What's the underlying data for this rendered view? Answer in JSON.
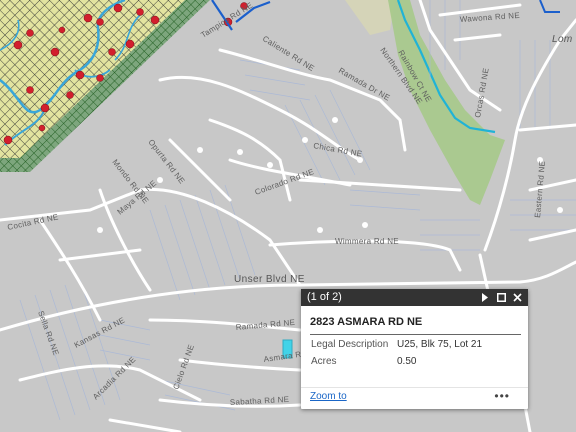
{
  "map": {
    "district_label": "Lom",
    "road_labels": {
      "tampico": "Tampico Rd NE",
      "caliente": "Caliente Rd NE",
      "mondo": "Mondo Rd NE",
      "ramada": "Ramada Dr NE",
      "chica": "Chica Rd NE",
      "taliaferro": "Taliaferro Rd NE",
      "opurta": "Opurta Rd NE",
      "maya": "Maya Rd NE",
      "cocita": "Cocita Rd NE",
      "sacadia": "Sacadia Rd NE",
      "colorado": "Colorado Rd NE",
      "wimmera": "Wimmera Rd NE",
      "unser": "Unser Blvd NE",
      "rainbow": "Rainbow Ct NE",
      "orcas": "Orcas Rd NE",
      "peterson": "Peterson Rd NE",
      "eliseo": "Eliseo Rd NE",
      "sella": "Sella Rd NE",
      "nutria": "Nutria Rd NE",
      "kansas": "Kansas Rd NE",
      "ramada2": "Ramada Rd NE",
      "arcadia": "Arcadia Rd NE",
      "cielo": "Cielo Rd NE",
      "asmara": "Asmara Rd NE",
      "sabatha": "Sabatha Rd NE",
      "bermuda": "Bermuda Rd NE",
      "wawona": "Wawona Rd NE",
      "eastern": "Eastern Rd NE",
      "quinta": "Quinta Rd NE",
      "northern": "Northern Blvd NE"
    }
  },
  "popup": {
    "counter": "(1 of 2)",
    "next_icon": "play-next-icon",
    "maximize_icon": "maximize-icon",
    "close_icon": "close-icon",
    "title": "2823 ASMARA RD NE",
    "attributes": [
      {
        "key": "Legal Description",
        "value": "U25, Blk 75, Lot 21"
      },
      {
        "key": "Acres",
        "value": "0.50"
      }
    ],
    "zoom_label": "Zoom to",
    "more_label": "•••"
  }
}
